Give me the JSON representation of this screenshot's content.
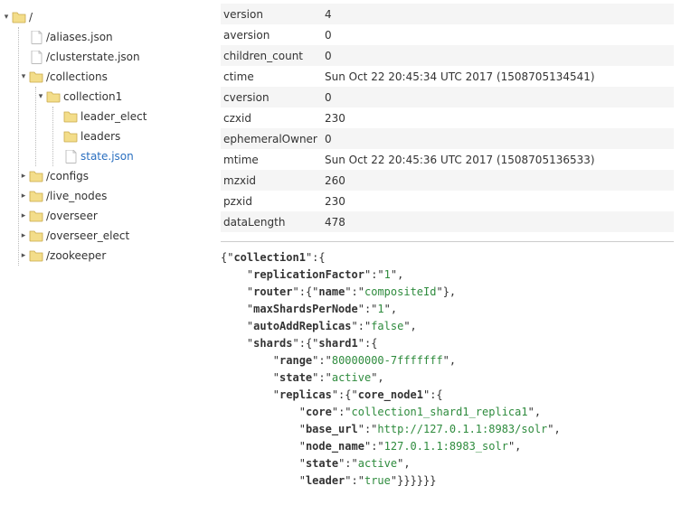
{
  "tree": {
    "root": {
      "label": "/",
      "type": "folder",
      "expanded": true
    },
    "aliases": {
      "label": "/aliases.json",
      "type": "file"
    },
    "clusterstate": {
      "label": "/clusterstate.json",
      "type": "file"
    },
    "collections": {
      "label": "/collections",
      "type": "folder",
      "expanded": true
    },
    "collection1": {
      "label": "collection1",
      "type": "folder",
      "expanded": true
    },
    "leader_elect": {
      "label": "leader_elect",
      "type": "folder"
    },
    "leaders": {
      "label": "leaders",
      "type": "folder"
    },
    "state_json": {
      "label": "state.json",
      "type": "file",
      "selected": true
    },
    "configs": {
      "label": "/configs",
      "type": "folder"
    },
    "live_nodes": {
      "label": "/live_nodes",
      "type": "folder"
    },
    "overseer": {
      "label": "/overseer",
      "type": "folder"
    },
    "overseer_elect": {
      "label": "/overseer_elect",
      "type": "folder"
    },
    "zookeeper": {
      "label": "/zookeeper",
      "type": "folder"
    }
  },
  "properties": [
    {
      "key": "version",
      "value": "4"
    },
    {
      "key": "aversion",
      "value": "0"
    },
    {
      "key": "children_count",
      "value": "0"
    },
    {
      "key": "ctime",
      "value": "Sun Oct 22 20:45:34 UTC 2017 (1508705134541)"
    },
    {
      "key": "cversion",
      "value": "0"
    },
    {
      "key": "czxid",
      "value": "230"
    },
    {
      "key": "ephemeralOwner",
      "value": "0"
    },
    {
      "key": "mtime",
      "value": "Sun Oct 22 20:45:36 UTC 2017 (1508705136533)"
    },
    {
      "key": "mzxid",
      "value": "260"
    },
    {
      "key": "pzxid",
      "value": "230"
    },
    {
      "key": "dataLength",
      "value": "478"
    }
  ],
  "json_data": {
    "root_key": "collection1",
    "replicationFactor_k": "replicationFactor",
    "replicationFactor_v": "1",
    "router_k": "router",
    "router_name_k": "name",
    "router_name_v": "compositeId",
    "maxShards_k": "maxShardsPerNode",
    "maxShards_v": "1",
    "autoAdd_k": "autoAddReplicas",
    "autoAdd_v": "false",
    "shards_k": "shards",
    "shard1_k": "shard1",
    "range_k": "range",
    "range_v": "80000000-7fffffff",
    "state_k": "state",
    "state_v": "active",
    "replicas_k": "replicas",
    "core_node_k": "core_node1",
    "core_k": "core",
    "core_v": "collection1_shard1_replica1",
    "base_url_k": "base_url",
    "base_url_v": "http://127.0.1.1:8983/solr",
    "node_name_k": "node_name",
    "node_name_v": "127.0.1.1:8983_solr",
    "state2_k": "state",
    "state2_v": "active",
    "leader_k": "leader",
    "leader_v": "true"
  }
}
